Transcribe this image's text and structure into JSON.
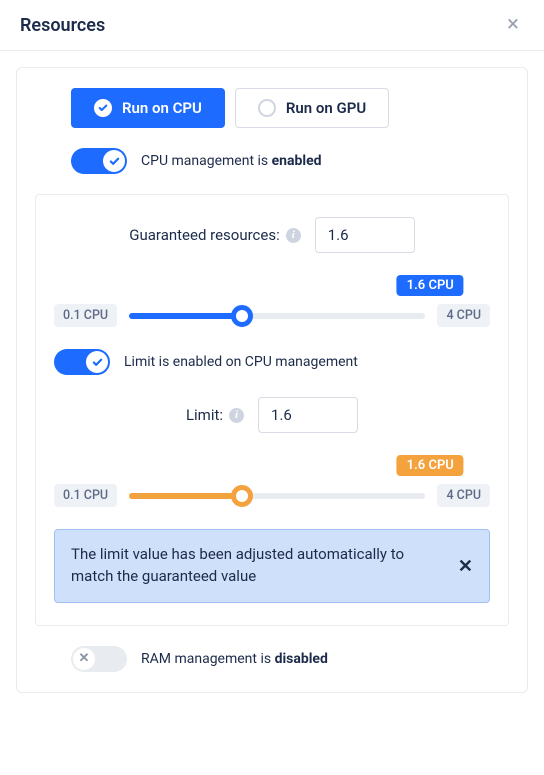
{
  "header": {
    "title": "Resources"
  },
  "mode": {
    "cpu": "Run on CPU",
    "gpu": "Run on GPU"
  },
  "cpu": {
    "toggle_prefix": "CPU management is ",
    "toggle_state": "enabled",
    "guaranteed_label": "Guaranteed resources:",
    "guaranteed_value": "1.6",
    "guaranteed_tip": "1.6 CPU",
    "limit_toggle": "Limit is enabled on CPU management",
    "limit_label": "Limit:",
    "limit_value": "1.6",
    "limit_tip": "1.6 CPU",
    "min": "0.1 CPU",
    "max": "4 CPU",
    "alert": "The limit value has been adjusted automatically to match the guaranteed value"
  },
  "ram": {
    "toggle_prefix": "RAM management is ",
    "toggle_state": "disabled"
  }
}
